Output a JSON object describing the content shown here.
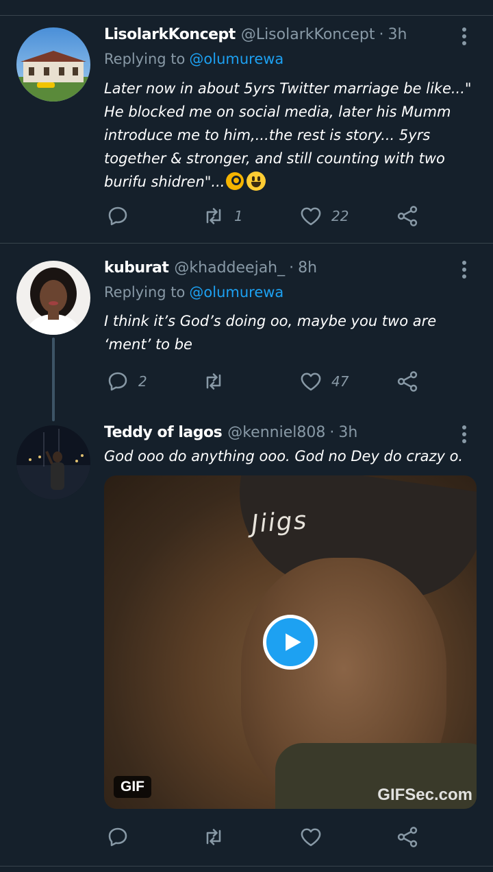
{
  "tweets": [
    {
      "name": "LisolarkKoncept",
      "handle": "@LisolarkKoncept",
      "dot": "·",
      "time": "3h",
      "replying_prefix": "Replying to",
      "replying_to": "@olumurewa",
      "text": "Later now in about 5yrs Twitter marriage be like...\" He blocked me on social media, later his Mumm introduce me to him,...the rest is story... 5yrs together & stronger, and still counting with two burifu shidren\"...",
      "reply_count": "",
      "retweet_count": "1",
      "like_count": "22"
    },
    {
      "name": "kuburat",
      "handle": "@khaddeejah_",
      "dot": "·",
      "time": "8h",
      "replying_prefix": "Replying to",
      "replying_to": "@olumurewa",
      "text": "I think it’s God’s doing oo, maybe you two are ‘ment’ to be",
      "reply_count": "2",
      "retweet_count": "",
      "like_count": "47"
    },
    {
      "name": "Teddy of lagos",
      "handle": "@kenniel808",
      "dot": "·",
      "time": "3h",
      "text": "God ooo do anything ooo. God no Dey do crazy o.",
      "media": {
        "badge": "GIF",
        "beanie_text": "Jiigs",
        "watermark": "GIFSec.com"
      },
      "reply_count": "",
      "retweet_count": "",
      "like_count": ""
    }
  ],
  "icons": {
    "reply": "reply-icon",
    "retweet": "retweet-icon",
    "like": "heart-icon",
    "share": "share-icon",
    "more": "more-vertical-icon",
    "play": "play-icon"
  },
  "colors": {
    "background": "#15202b",
    "accent": "#1da1f2",
    "muted": "#8899a6",
    "divider": "#38444d"
  }
}
